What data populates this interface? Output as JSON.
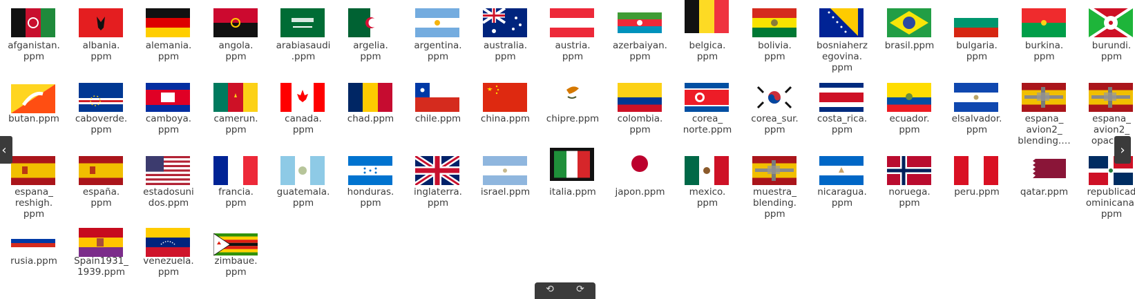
{
  "files": [
    {
      "label": [
        "afganistan.",
        "ppm"
      ],
      "icon": "flag-afghanistan"
    },
    {
      "label": [
        "albania.",
        "ppm"
      ],
      "icon": "flag-albania"
    },
    {
      "label": [
        "alemania.",
        "ppm"
      ],
      "icon": "flag-germany"
    },
    {
      "label": [
        "angola.",
        "ppm"
      ],
      "icon": "flag-angola"
    },
    {
      "label": [
        "arabiasaudi",
        ".ppm"
      ],
      "icon": "flag-saudi-arabia"
    },
    {
      "label": [
        "argelia.",
        "ppm"
      ],
      "icon": "flag-algeria"
    },
    {
      "label": [
        "argentina.",
        "ppm"
      ],
      "icon": "flag-argentina"
    },
    {
      "label": [
        "australia.",
        "ppm"
      ],
      "icon": "flag-australia"
    },
    {
      "label": [
        "austria.",
        "ppm"
      ],
      "icon": "flag-austria"
    },
    {
      "label": [
        "azerbaiyan.",
        "ppm"
      ],
      "icon": "flag-azerbaijan"
    },
    {
      "label": [
        "belgica.",
        "ppm"
      ],
      "icon": "flag-belgium"
    },
    {
      "label": [
        "bolivia.",
        "ppm"
      ],
      "icon": "flag-bolivia"
    },
    {
      "label": [
        "bosniaherz",
        "egovina.",
        "ppm"
      ],
      "icon": "flag-bosnia"
    },
    {
      "label": [
        "brasil.ppm"
      ],
      "icon": "flag-brazil"
    },
    {
      "label": [
        "bulgaria.",
        "ppm"
      ],
      "icon": "flag-bulgaria"
    },
    {
      "label": [
        "burkina.",
        "ppm"
      ],
      "icon": "flag-burkina-faso"
    },
    {
      "label": [
        "burundi.",
        "ppm"
      ],
      "icon": "flag-burundi"
    },
    {
      "label": [
        "butan.ppm"
      ],
      "icon": "flag-bhutan"
    },
    {
      "label": [
        "caboverde.",
        "ppm"
      ],
      "icon": "flag-cape-verde"
    },
    {
      "label": [
        "camboya.",
        "ppm"
      ],
      "icon": "flag-cambodia"
    },
    {
      "label": [
        "camerun.",
        "ppm"
      ],
      "icon": "flag-cameroon"
    },
    {
      "label": [
        "canada.",
        "ppm"
      ],
      "icon": "flag-canada"
    },
    {
      "label": [
        "chad.ppm"
      ],
      "icon": "flag-chad"
    },
    {
      "label": [
        "chile.ppm"
      ],
      "icon": "flag-chile"
    },
    {
      "label": [
        "china.ppm"
      ],
      "icon": "flag-china"
    },
    {
      "label": [
        "chipre.ppm"
      ],
      "icon": "flag-cyprus"
    },
    {
      "label": [
        "colombia.",
        "ppm"
      ],
      "icon": "flag-colombia"
    },
    {
      "label": [
        "corea_",
        "norte.ppm"
      ],
      "icon": "flag-north-korea"
    },
    {
      "label": [
        "corea_sur.",
        "ppm"
      ],
      "icon": "flag-south-korea"
    },
    {
      "label": [
        "costa_rica.",
        "ppm"
      ],
      "icon": "flag-costa-rica"
    },
    {
      "label": [
        "ecuador.",
        "ppm"
      ],
      "icon": "flag-ecuador"
    },
    {
      "label": [
        "elsalvador.",
        "ppm"
      ],
      "icon": "flag-el-salvador"
    },
    {
      "label": [
        "espana_",
        "avion2_",
        "blending.…"
      ],
      "icon": "flag-spain-plane"
    },
    {
      "label": [
        "espana_",
        "avion2_",
        "opaco.…"
      ],
      "icon": "flag-spain-plane"
    },
    {
      "label": [
        "espana_",
        "reshigh.",
        "ppm"
      ],
      "icon": "flag-spain"
    },
    {
      "label": [
        "españa.",
        "ppm"
      ],
      "icon": "flag-spain"
    },
    {
      "label": [
        "estadosuni",
        "dos.ppm"
      ],
      "icon": "flag-usa"
    },
    {
      "label": [
        "francia.",
        "ppm"
      ],
      "icon": "flag-france"
    },
    {
      "label": [
        "guatemala.",
        "ppm"
      ],
      "icon": "flag-guatemala"
    },
    {
      "label": [
        "honduras.",
        "ppm"
      ],
      "icon": "flag-honduras"
    },
    {
      "label": [
        "inglaterra.",
        "ppm"
      ],
      "icon": "flag-uk"
    },
    {
      "label": [
        "israel.ppm"
      ],
      "icon": "flag-israel"
    },
    {
      "label": [
        "italia.ppm"
      ],
      "icon": "flag-italy-blurred"
    },
    {
      "label": [
        "japon.ppm"
      ],
      "icon": "flag-japan"
    },
    {
      "label": [
        "mexico.",
        "ppm"
      ],
      "icon": "flag-mexico"
    },
    {
      "label": [
        "muestra_",
        "blending.",
        "ppm"
      ],
      "icon": "flag-spain-plane"
    },
    {
      "label": [
        "nicaragua.",
        "ppm"
      ],
      "icon": "flag-nicaragua"
    },
    {
      "label": [
        "noruega.",
        "ppm"
      ],
      "icon": "flag-norway"
    },
    {
      "label": [
        "peru.ppm"
      ],
      "icon": "flag-peru"
    },
    {
      "label": [
        "qatar.ppm"
      ],
      "icon": "flag-qatar"
    },
    {
      "label": [
        "republicad",
        "ominicana.",
        "ppm"
      ],
      "icon": "flag-dominican-republic"
    },
    {
      "label": [
        "rusia.ppm"
      ],
      "icon": "flag-russia"
    },
    {
      "label": [
        "Spain1931_",
        "1939.ppm"
      ],
      "icon": "flag-spain-1931"
    },
    {
      "label": [
        "venezuela.",
        "ppm"
      ],
      "icon": "flag-venezuela"
    },
    {
      "label": [
        "zimbaue.",
        "ppm"
      ],
      "icon": "flag-zimbabwe"
    }
  ],
  "navigation": {
    "prev_glyph": "‹",
    "next_glyph": "›",
    "rotate_left_glyph": "⟲",
    "rotate_right_glyph": "⟳"
  }
}
